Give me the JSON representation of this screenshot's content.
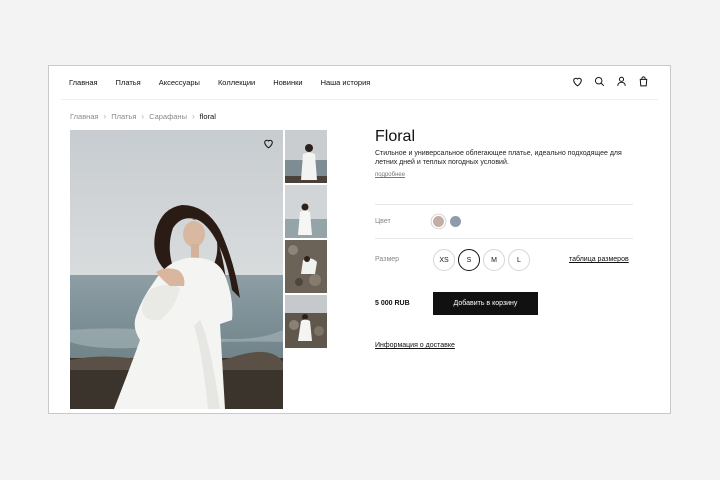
{
  "nav": {
    "items": [
      "Главная",
      "Платья",
      "Аксессуары",
      "Коллекции",
      "Новинки",
      "Наша история"
    ],
    "icons": [
      "heart-icon",
      "search-icon",
      "user-icon",
      "bag-icon"
    ]
  },
  "breadcrumb": {
    "items": [
      "Главная",
      "Платья",
      "Сарафаны"
    ],
    "current": "floral"
  },
  "product": {
    "title": "Floral",
    "description": "Стильное и универсальное облегающее платье, идеально подходящее для летних дней и теплых погодных условий.",
    "more_link": "подробнее",
    "color_label": "Цвет",
    "colors": [
      "#c4ada5",
      "#8f9bab"
    ],
    "selected_color": 0,
    "size_label": "Размер",
    "sizes": [
      "XS",
      "S",
      "M",
      "L"
    ],
    "selected_size": "S",
    "size_table_link": "таблица размеров",
    "price": "5 000 RUB",
    "add_to_cart": "Добавить в корзину",
    "delivery_link": "Информация о доставке"
  },
  "gallery": {
    "main_image": "woman-white-dress-seaside",
    "thumbnail_count": 4
  }
}
